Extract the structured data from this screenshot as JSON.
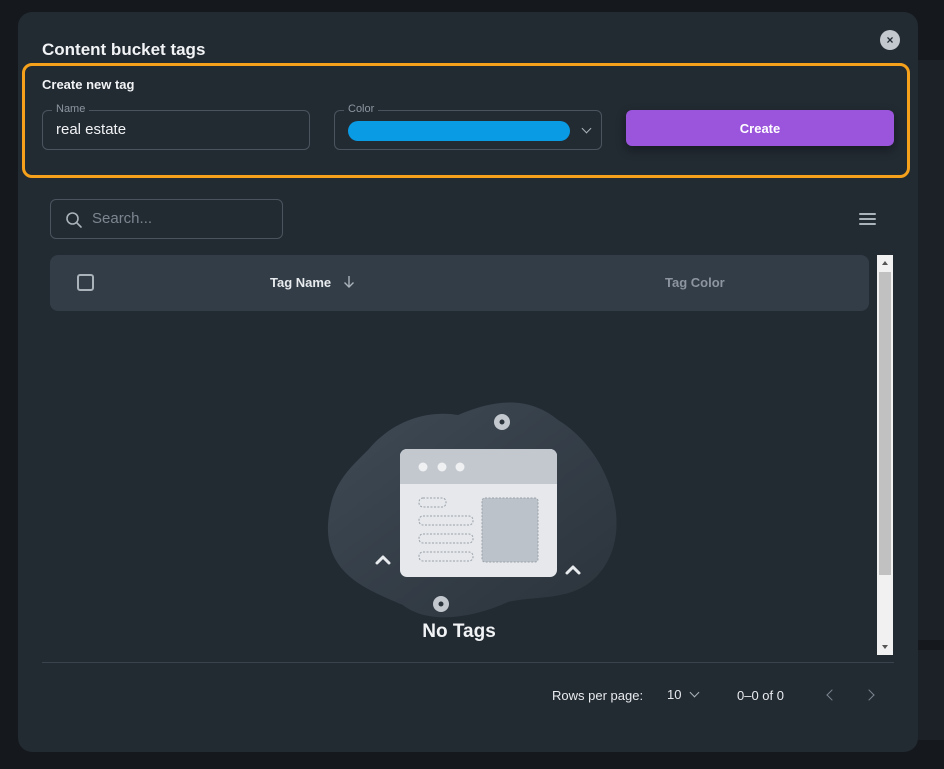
{
  "modal": {
    "title": "Content bucket tags",
    "close_symbol": "×"
  },
  "create_panel": {
    "title": "Create new tag",
    "name_label": "Name",
    "name_value": "real estate",
    "color_label": "Color",
    "color_value": "#0a9be5",
    "create_button_label": "Create"
  },
  "search": {
    "placeholder": "Search..."
  },
  "table": {
    "columns": [
      "Tag Name",
      "Tag Color"
    ],
    "sorted_column": "Tag Name",
    "sort_direction": "descending",
    "rows": []
  },
  "empty_state": {
    "message": "No Tags"
  },
  "pagination": {
    "rows_per_page_label": "Rows per page:",
    "rows_per_page_value": "10",
    "range_text": "0–0 of 0"
  },
  "icons": [
    "close-icon",
    "search-icon",
    "menu-icon",
    "sort-arrow-icon",
    "chevron-down-icon",
    "chevron-left-icon",
    "chevron-right-icon"
  ],
  "colors": {
    "modal_bg": "#222a32",
    "highlight_border": "#f5a11b",
    "create_button": "#9b55dc",
    "selected_color": "#0a9be5"
  }
}
